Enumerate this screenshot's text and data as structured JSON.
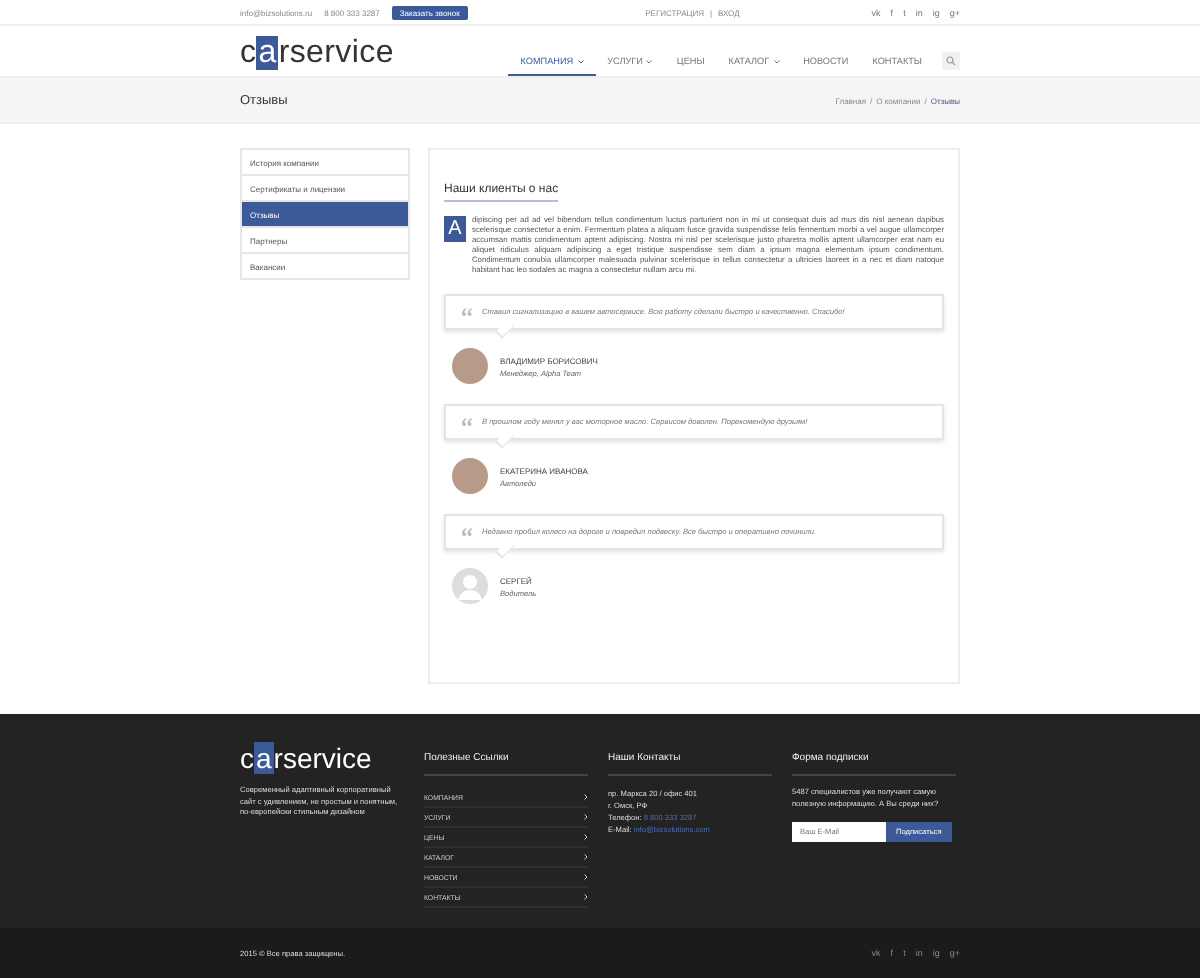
{
  "top_bar": {
    "email": "info@bizsolutions.ru",
    "phone": "8 800 333 3287",
    "callback_button": "Заказать звонок",
    "register": "РЕГИСТРАЦИЯ",
    "separator": "|",
    "login": "ВХОД",
    "social": [
      "vk",
      "f",
      "t",
      "in",
      "ig",
      "g+"
    ]
  },
  "logo": {
    "before": "c",
    "highlight": "a",
    "after": "rservice"
  },
  "nav": [
    {
      "label": "КОМПАНИЯ",
      "dropdown": true,
      "selected": true
    },
    {
      "label": "УСЛУГИ",
      "dropdown": true,
      "selected": false
    },
    {
      "label": "ЦЕНЫ",
      "dropdown": false,
      "selected": false
    },
    {
      "label": "КАТАЛОГ",
      "dropdown": true,
      "selected": false
    },
    {
      "label": "НОВОСТИ",
      "dropdown": false,
      "selected": false
    },
    {
      "label": "КОНТАКТЫ",
      "dropdown": false,
      "selected": false
    }
  ],
  "page_title": "Отзывы",
  "breadcrumbs": [
    {
      "label": "Главная",
      "current": false
    },
    {
      "separator": "/",
      "label": "О компании",
      "current": false
    },
    {
      "separator": "/",
      "label": "Отзывы",
      "current": true
    }
  ],
  "sidebar": {
    "items": [
      {
        "label": "История компании",
        "selected": false
      },
      {
        "label": "Сертификаты и лицензии",
        "selected": false
      },
      {
        "label": "Отзывы",
        "selected": true
      },
      {
        "label": "Партнеры",
        "selected": false
      },
      {
        "label": "Вакансии",
        "selected": false
      }
    ]
  },
  "content": {
    "heading": "Наши клиенты о нас",
    "drop_cap": "A",
    "paragraph": "dipiscing per ad ad vel bibendum tellus condimentum luctus parturient non in mi ut consequat duis ad mus dis nisl aenean dapibus scelerisque consectetur a enim. Fermentum platea a aliquam fusce gravida suspendisse felis fermentum morbi a vel augue ullamcorper accumsan mattis condimentum aptent adipiscing. Nostra mi nisl per scelerisque justo pharetra mollis aptent ullamcorper erat nam eu aliquet ridiculus aliquam adipiscing a eget tristique suspendisse sem diam a ipsum magna elementum ipsum condimentum. Condimentum conubia ullamcorper malesuada pulvinar scelerisque in tellus consectetur a ultricies laoreet in a nec et diam natoque habitant hac leo sodales ac magna a consectetur nullam arcu mi.",
    "testimonials": [
      {
        "quote": "Ставил сигнализацию в вашем автосервисе. Всю работу сделали быстро и качественно. Спасибо!",
        "name": "ВЛАДИМИР БОРИСОВИЧ",
        "role": "Менеджер, Alpha Team",
        "kind": "photo"
      },
      {
        "quote": "В прошлом году менял у вас моторное масло. Сервисом доволен. Порекомендую друзьям!",
        "name": "ЕКАТЕРИНА ИВАНОВА",
        "role": "Автоледи",
        "kind": "photo"
      },
      {
        "quote": "Недавно пробил колесо на дороге и повредил подвеску. Все быстро и оперативно починили.",
        "name": "СЕРГЕЙ",
        "role": "Водитель",
        "kind": "silhouette"
      }
    ]
  },
  "footer": {
    "logo": {
      "before": "c",
      "highlight": "a",
      "after": "rservice"
    },
    "about": "Современный адаптивный корпоративный сайт с удивлением, не простым и понятным, по-европейски стильным дизайном",
    "links_title": "Полезные Ссылки",
    "links": [
      "КОМПАНИЯ",
      "УСЛУГИ",
      "ЦЕНЫ",
      "КАТАЛОГ",
      "НОВОСТИ",
      "КОНТАКТЫ"
    ],
    "contacts_title": "Наши Контакты",
    "address_1": "пр. Маркса 20 / офис 401",
    "address_2": "г. Омск, РФ",
    "phone_label": "Телефон:",
    "phone": "8 800 333 3287",
    "email_label": "E-Mail:",
    "email": "info@bizsolutions.com",
    "subscribe_title": "Форма подписки",
    "subscribe_text": "5487 специалистов уже получают самую полезную информацию. А Вы среди них?",
    "email_placeholder": "Ваш E-Mail",
    "subscribe_button": "Подписаться"
  },
  "bottom_bar": {
    "copyright": "2015 © Все права защищены.",
    "social": [
      "vk",
      "f",
      "t",
      "in",
      "ig",
      "g+"
    ]
  }
}
